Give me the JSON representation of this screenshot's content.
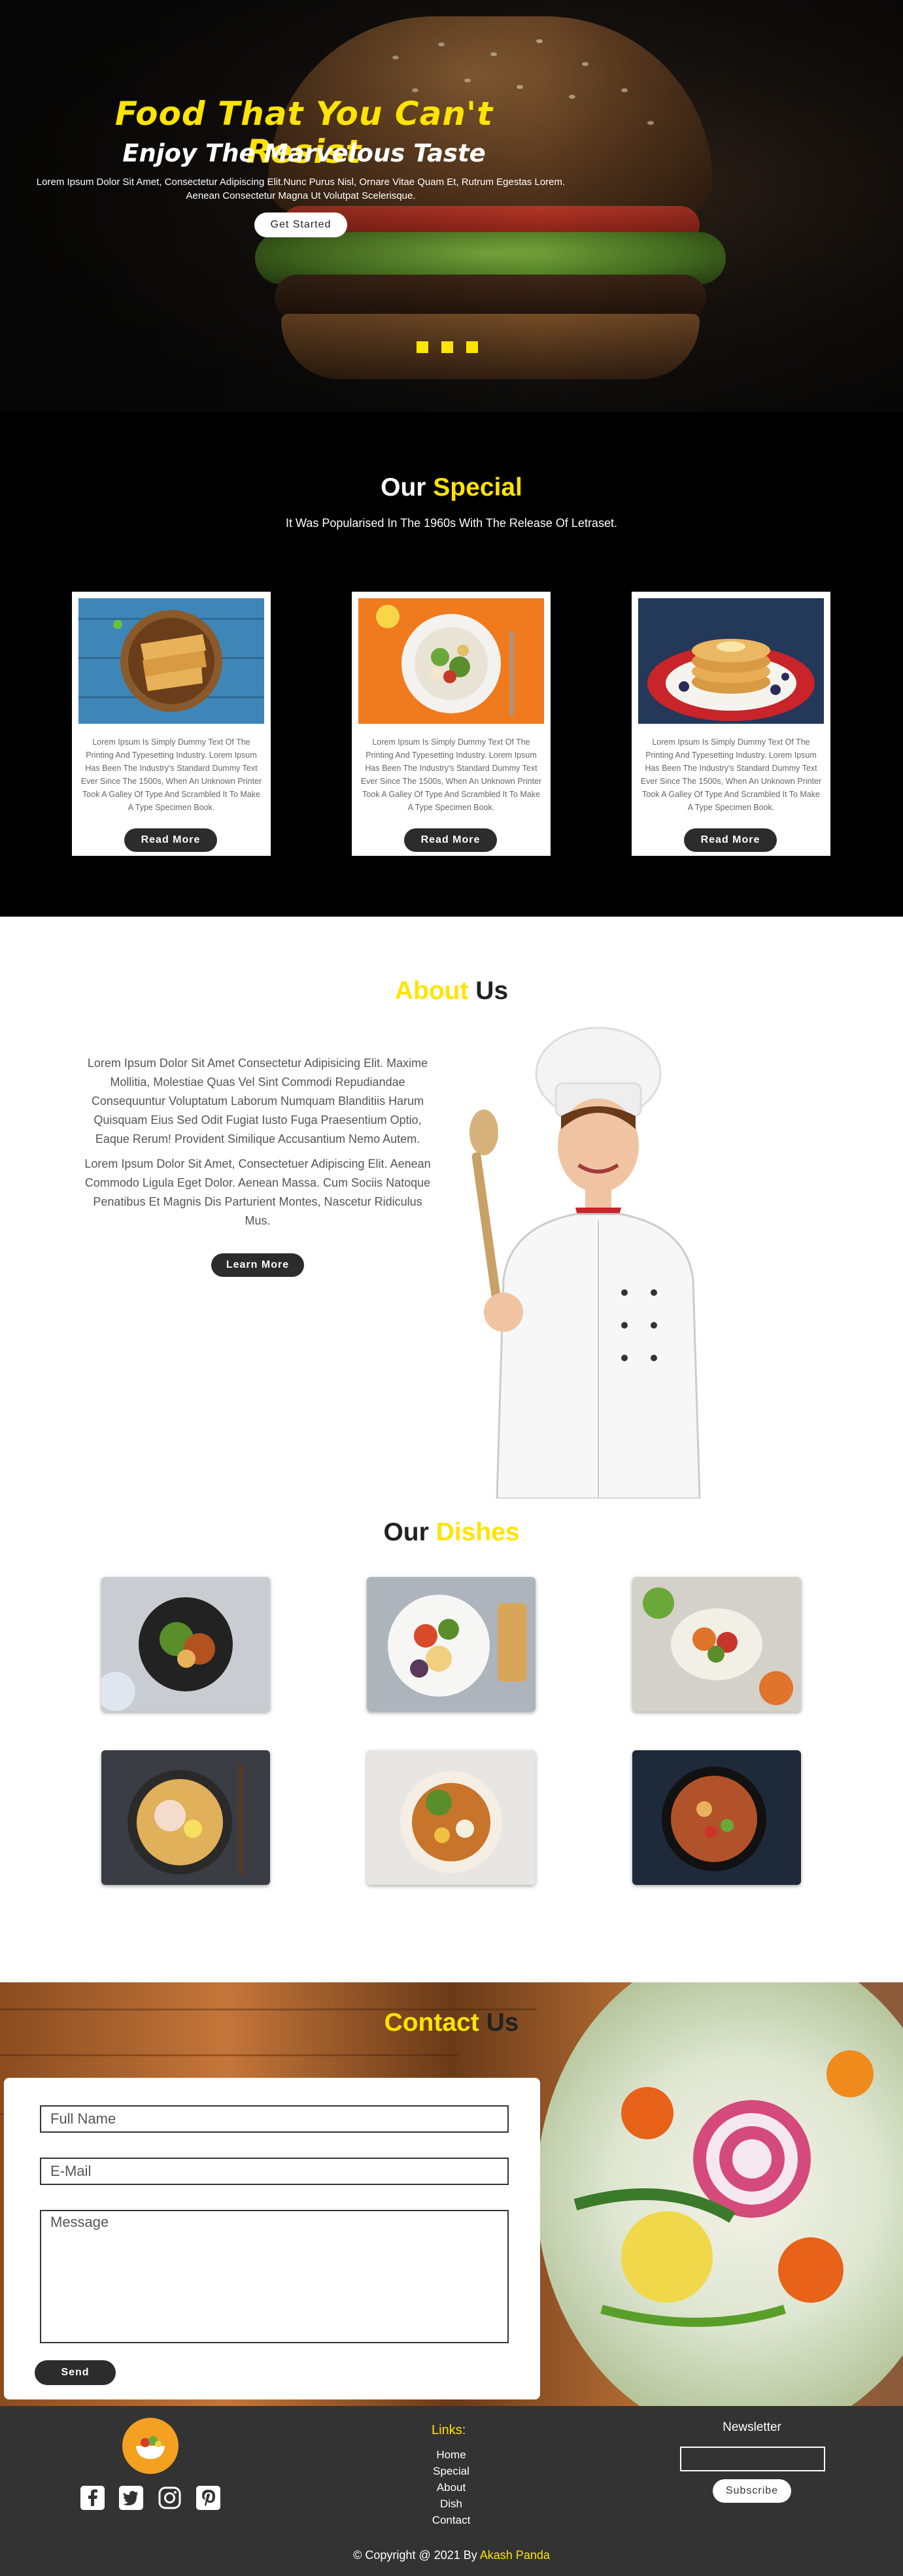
{
  "hero": {
    "title": "Food That You Can't Resist",
    "subtitle": "Enjoy The Marvelous Taste",
    "text_line1": "Lorem Ipsum Dolor Sit Amet, Consectetur Adipiscing Elit.Nunc Purus Nisl, Ornare Vitae Quam Et, Rutrum Egestas Lorem.",
    "text_line2": "Aenean Consectetur Magna Ut Volutpat Scelerisque.",
    "cta_label": "Get Started",
    "slides_count": 3,
    "accent_color": "#ffe400"
  },
  "special": {
    "title_prefix": "Our",
    "title_accent": "Special",
    "subtitle": "It Was Popularised In The 1960s With The Release Of Letraset.",
    "cards": [
      {
        "image": "toast-plate",
        "text": "Lorem Ipsum Is Simply Dummy Text Of The Printing And Typesetting Industry. Lorem Ipsum Has Been The Industry's Standard Dummy Text Ever Since The 1500s, When An Unknown Printer Took A Galley Of Type And Scrambled It To Make A Type Specimen Book.",
        "button": "Read More"
      },
      {
        "image": "salad-plate",
        "text": "Lorem Ipsum Is Simply Dummy Text Of The Printing And Typesetting Industry. Lorem Ipsum Has Been The Industry's Standard Dummy Text Ever Since The 1500s, When An Unknown Printer Took A Galley Of Type And Scrambled It To Make A Type Specimen Book.",
        "button": "Read More"
      },
      {
        "image": "pancake-plate",
        "text": "Lorem Ipsum Is Simply Dummy Text Of The Printing And Typesetting Industry. Lorem Ipsum Has Been The Industry's Standard Dummy Text Ever Since The 1500s, When An Unknown Printer Took A Galley Of Type And Scrambled It To Make A Type Specimen Book.",
        "button": "Read More"
      }
    ]
  },
  "about": {
    "title_accent": "About",
    "title_suffix": "Us",
    "para1": "Lorem Ipsum Dolor Sit Amet Consectetur Adipisicing Elit. Maxime Mollitia, Molestiae Quas Vel Sint Commodi Repudiandae Consequuntur Voluptatum Laborum Numquam Blanditiis Harum Quisquam Eius Sed Odit Fugiat Iusto Fuga Praesentium Optio, Eaque Rerum! Provident Similique Accusantium Nemo Autem.",
    "para2": "Lorem Ipsum Dolor Sit Amet, Consectetuer Adipiscing Elit. Aenean Commodo Ligula Eget Dolor. Aenean Massa. Cum Sociis Natoque Penatibus Et Magnis Dis Parturient Montes, Nascetur Ridiculus Mus.",
    "button": "Learn More"
  },
  "dishes": {
    "title_prefix": "Our",
    "title_accent": "Dishes",
    "items": [
      "dish-1",
      "dish-2",
      "dish-3",
      "dish-4",
      "dish-5",
      "dish-6"
    ]
  },
  "contact": {
    "title_accent": "Contact",
    "title_suffix": "Us",
    "name_placeholder": "Full Name",
    "email_placeholder": "E-Mail",
    "message_placeholder": "Message",
    "send_label": "Send"
  },
  "footer": {
    "links_title": "Links:",
    "links": [
      "Home",
      "Special",
      "About",
      "Dish",
      "Contact"
    ],
    "newsletter_title": "Newsletter",
    "subscribe_label": "Subscribe",
    "social_icons": [
      "facebook-icon",
      "twitter-icon",
      "instagram-icon",
      "pinterest-icon"
    ],
    "copyright_prefix": "© Copyright @ 2021 By",
    "copyright_author": "Akash Panda"
  }
}
